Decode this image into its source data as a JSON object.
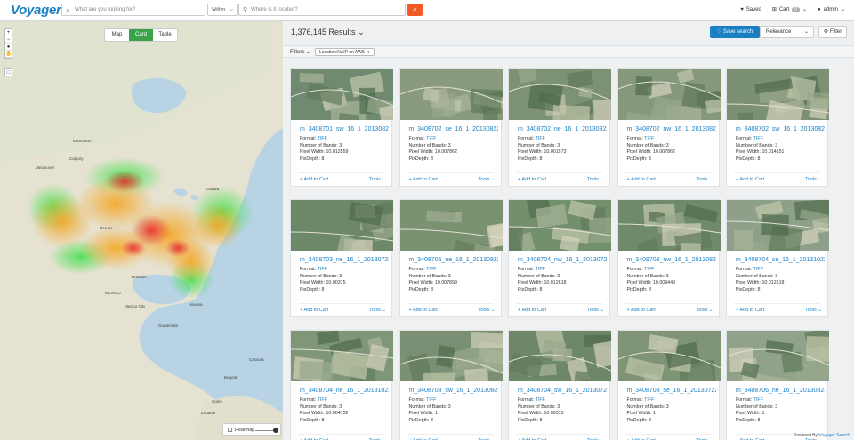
{
  "header": {
    "logo": "Voyager",
    "search_placeholder": "What are you looking for?",
    "within_label": "Within",
    "location_placeholder": "Where is it located?",
    "saved_label": "Saved",
    "cart_label": "Cart",
    "cart_count": "0",
    "user_label": "admin"
  },
  "map": {
    "views": [
      "Map",
      "Card",
      "Table"
    ],
    "active_view": "Card",
    "heatmap_label": "Heatmap",
    "place_labels": [
      "Calgary",
      "Edmonton",
      "Vancouver",
      "Denver",
      "Ottawa",
      "Houston",
      "MEXICO",
      "Mexico City",
      "Guatemala",
      "Havana",
      "Caracas",
      "Bogotá",
      "Quito",
      "Lima",
      "Ecuador"
    ]
  },
  "results": {
    "count_label": "1,376,145 Results",
    "save_search_label": "Save search",
    "sort_label": "Relevance",
    "filter_label": "Filter",
    "filters_label": "Filters",
    "active_filter": "Location:NAIP on AWS"
  },
  "card_labels": {
    "format": "Format:",
    "bands": "Number of Bands:",
    "pixel_width": "Pixel Width:",
    "pixdepth": "PixDepth:",
    "add_to_cart": "Add to Cart",
    "tools": "Tools"
  },
  "cards": [
    {
      "title": "m_3408701_sw_16_1_20130822",
      "format": "TIFF",
      "bands": "3",
      "pixel_width": "10.012559",
      "pixdepth": "8",
      "tone": "#6f8a70"
    },
    {
      "title": "m_3408702_se_16_1_20130822",
      "format": "TIFF",
      "bands": "3",
      "pixel_width": "10.007862",
      "pixdepth": "8",
      "tone": "#8a9a7e"
    },
    {
      "title": "m_3408702_ne_16_1_20130822",
      "format": "TIFF",
      "bands": "3",
      "pixel_width": "10.001573",
      "pixdepth": "8",
      "tone": "#7d9275"
    },
    {
      "title": "m_3408702_nw_16_1_20130822",
      "format": "TIFF",
      "bands": "3",
      "pixel_width": "10.007862",
      "pixdepth": "8",
      "tone": "#86987c"
    },
    {
      "title": "m_3408702_sw_16_1_20130822",
      "format": "TIFF",
      "bands": "3",
      "pixel_width": "10.014151",
      "pixdepth": "8",
      "tone": "#7c9173"
    },
    {
      "title": "m_3408703_ne_16_1_20130722",
      "format": "TIFF",
      "bands": "3",
      "pixel_width": "10.00315",
      "pixdepth": "8",
      "tone": "#6c8868"
    },
    {
      "title": "m_3408705_ne_16_1_20130822",
      "format": "TIFF",
      "bands": "3",
      "pixel_width": "10.007899",
      "pixdepth": "8",
      "tone": "#7a9270"
    },
    {
      "title": "m_3408704_nw_16_1_20130722",
      "format": "TIFF",
      "bands": "3",
      "pixel_width": "10.012618",
      "pixdepth": "8",
      "tone": "#73906d"
    },
    {
      "title": "m_3408703_nw_16_1_20130822",
      "format": "TIFF",
      "bands": "3",
      "pixel_width": "10.009449",
      "pixdepth": "8",
      "tone": "#6f8a6a"
    },
    {
      "title": "m_3408704_se_16_1_20131022",
      "format": "TIFF",
      "bands": "3",
      "pixel_width": "10.012618",
      "pixdepth": "8",
      "tone": "#8fa08a"
    },
    {
      "title": "m_3408704_ne_16_1_20131022",
      "format": "TIFF",
      "bands": "3",
      "pixel_width": "10.004732",
      "pixdepth": "8",
      "tone": "#7f9678"
    },
    {
      "title": "m_3408703_sw_16_1_20130822",
      "format": "TIFF",
      "bands": "3",
      "pixel_width": "1",
      "pixdepth": "8",
      "tone": "#7a8f73"
    },
    {
      "title": "m_3408704_sw_16_1_20130722",
      "format": "TIFF",
      "bands": "3",
      "pixel_width": "10.00315",
      "pixdepth": "8",
      "tone": "#6e8769"
    },
    {
      "title": "m_3408703_se_16_1_20130722",
      "format": "TIFF",
      "bands": "3",
      "pixel_width": "1",
      "pixdepth": "8",
      "tone": "#7e9474"
    },
    {
      "title": "m_3408706_ne_16_1_20130822",
      "format": "TIFF",
      "bands": "3",
      "pixel_width": "1",
      "pixdepth": "8",
      "tone": "#90a28a"
    }
  ],
  "footer": {
    "powered_prefix": "Powered By",
    "powered_brand": "Voyager Search"
  },
  "colors": {
    "brand_blue": "#1b7fc4",
    "accent_orange": "#f15a24",
    "active_green": "#3aa34a"
  }
}
